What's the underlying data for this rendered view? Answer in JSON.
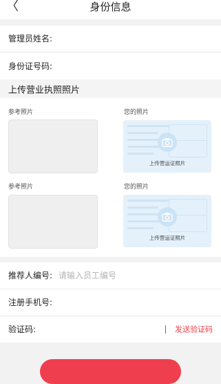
{
  "navbar": {
    "back_glyph": "〈",
    "title": "身份信息"
  },
  "fields": {
    "admin_name_label": "管理员姓名:",
    "id_number_label": "身份证号码:"
  },
  "upload": {
    "section_title": "上传营业执照照片",
    "groups": [
      {
        "reference_label": "参考照片",
        "your_label": "您的照片",
        "hint": "上传营运证照片"
      },
      {
        "reference_label": "参考照片",
        "your_label": "您的照片",
        "hint": "上传营运证照片"
      }
    ]
  },
  "referrer": {
    "label": "推荐人编号:",
    "placeholder": "请输入员工编号"
  },
  "phone": {
    "label": "注册手机号:"
  },
  "code": {
    "label": "验证码:",
    "send_label": "发送验证码"
  },
  "colors": {
    "accent": "#e8414b",
    "photo_placeholder_bg": "#e4f1fb"
  },
  "icons": {
    "back": "chevron-left-icon",
    "camera": "camera-icon"
  }
}
